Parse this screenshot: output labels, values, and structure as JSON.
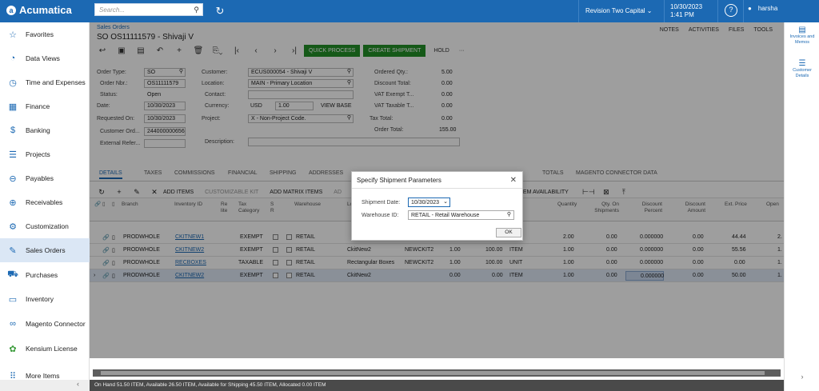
{
  "topbar": {
    "logo": "Acumatica",
    "search_placeholder": "Search...",
    "tenant": "Revision Two Capital",
    "date": "10/30/2023",
    "time": "1:41 PM",
    "user": "harsha"
  },
  "sidebar": {
    "items": [
      {
        "label": "Favorites",
        "icon": "star-icon"
      },
      {
        "label": "Data Views",
        "icon": "pie-chart-icon"
      },
      {
        "label": "Time and Expenses",
        "icon": "clock-icon"
      },
      {
        "label": "Finance",
        "icon": "calculator-icon"
      },
      {
        "label": "Banking",
        "icon": "dollar-icon"
      },
      {
        "label": "Projects",
        "icon": "projects-icon"
      },
      {
        "label": "Payables",
        "icon": "minus-circle-icon"
      },
      {
        "label": "Receivables",
        "icon": "plus-circle-icon"
      },
      {
        "label": "Customization",
        "icon": "customization-icon"
      },
      {
        "label": "Sales Orders",
        "icon": "sales-orders-icon"
      },
      {
        "label": "Purchases",
        "icon": "cart-icon"
      },
      {
        "label": "Inventory",
        "icon": "truck-icon"
      },
      {
        "label": "Magento Connector",
        "icon": "magento-icon"
      },
      {
        "label": "Kensium License",
        "icon": "kensium-icon"
      },
      {
        "label": "More Items",
        "icon": "grid-icon"
      }
    ]
  },
  "page": {
    "breadcrumb": "Sales Orders",
    "title": "SO OS11111579 - Shivaji V",
    "links": [
      "NOTES",
      "ACTIVITIES",
      "FILES",
      "TOOLS"
    ],
    "actions": {
      "process": "QUICK PROCESS",
      "shipment": "CREATE SHIPMENT",
      "hold": "HOLD",
      "more": "···"
    }
  },
  "form": {
    "order_type_label": "Order Type:",
    "order_type": "SO",
    "order_nbr_label": "Order Nbr.:",
    "order_nbr": "OS11111579",
    "status_label": "Status:",
    "status": "Open",
    "date_label": "Date:",
    "date": "10/30/2023",
    "requested_label": "Requested On:",
    "requested": "10/30/2023",
    "customer_ord_label": "Customer Ord...",
    "customer_ord": "244000000656",
    "external_label": "External Refer...",
    "external": "",
    "customer_label": "Customer:",
    "customer": "ECUS000054 - Shivaji V",
    "location_label": "Location:",
    "location": "MAIN - Primary Location",
    "contact_label": "Contact:",
    "contact": "",
    "currency_label": "Currency:",
    "currency": "USD",
    "rate": "1.00",
    "view_base": "VIEW BASE",
    "project_label": "Project:",
    "project": "X - Non-Project Code.",
    "description_label": "Description:",
    "description": "",
    "ordered_qty_label": "Ordered Qty.:",
    "ordered_qty": "5.00",
    "discount_label": "Discount Total:",
    "discount": "0.00",
    "vat_exempt_label": "VAT Exempt T...",
    "vat_exempt": "0.00",
    "vat_taxable_label": "VAT Taxable T...",
    "vat_taxable": "0.00",
    "tax_total_label": "Tax Total:",
    "tax_total": "0.00",
    "order_total_label": "Order Total:",
    "order_total": "155.00"
  },
  "tabs": [
    "DETAILS",
    "TAXES",
    "COMMISSIONS",
    "FINANCIAL",
    "SHIPPING",
    "ADDRESSES",
    "TOTALS",
    "MAGENTO CONNECTOR DATA"
  ],
  "grid_toolbar": [
    "ADD ITEMS",
    "CUSTOMIZABLE KIT",
    "ADD MATRIX ITEMS",
    "AD",
    "K",
    "ITEM AVAILABILITY"
  ],
  "grid": {
    "headers": [
      "Branch",
      "Inventory ID",
      "Re lite",
      "Tax Category",
      "S R",
      "Warehouse",
      "Lo",
      "Quantity",
      "Qty. On Shipments",
      "Discount Percent",
      "Discount Amount",
      "Ext. Price",
      "Open"
    ],
    "rows": [
      {
        "branch": "PRODWHOLE",
        "inventory": "CKITNEW1",
        "tax": "EXEMPT",
        "warehouse": "RETAIL",
        "desc": "",
        "kit": "",
        "q1": "",
        "q2": "",
        "uom": "",
        "qty": "2.00",
        "qty_ship": "0.00",
        "disc_pct": "0.000000",
        "disc_amt": "0.00",
        "ext": "44.44",
        "open": "2."
      },
      {
        "branch": "PRODWHOLE",
        "inventory": "CKITNEW2",
        "tax": "EXEMPT",
        "warehouse": "RETAIL",
        "desc": "CkitNew2",
        "kit": "NEWCKIT2",
        "q1": "1.00",
        "q2": "100.00",
        "uom": "ITEM",
        "qty": "1.00",
        "qty_ship": "0.00",
        "disc_pct": "0.000000",
        "disc_amt": "0.00",
        "ext": "55.56",
        "open": "1."
      },
      {
        "branch": "PRODWHOLE",
        "inventory": "RECBOXES",
        "tax": "TAXABLE",
        "warehouse": "RETAIL",
        "desc": "Rectangular Boxes",
        "kit": "NEWCKIT2",
        "q1": "1.00",
        "q2": "100.00",
        "uom": "UNIT",
        "qty": "1.00",
        "qty_ship": "0.00",
        "disc_pct": "0.000000",
        "disc_amt": "0.00",
        "ext": "0.00",
        "open": "1."
      },
      {
        "branch": "PRODWHOLE",
        "inventory": "CKITNEW2",
        "tax": "EXEMPT",
        "warehouse": "RETAIL",
        "desc": "CkitNew2",
        "kit": "",
        "q1": "0.00",
        "q2": "0.00",
        "uom": "ITEM",
        "qty": "1.00",
        "qty_ship": "0.00",
        "disc_pct": "0.000000",
        "disc_amt": "0.00",
        "ext": "50.00",
        "open": "1."
      }
    ]
  },
  "status_bar": "On Hand 51.50 ITEM, Available 26.50 ITEM, Available for Shipping 45.50 ITEM, Allocated 0.00 ITEM",
  "right_panel": [
    "Invoices and Memos",
    "Customer Details"
  ],
  "dialog": {
    "title": "Specify Shipment Parameters",
    "shipment_date_label": "Shipment Date:",
    "shipment_date": "10/30/2023",
    "warehouse_label": "Warehouse ID:",
    "warehouse": "RETAIL - Retail Warehouse",
    "ok": "OK"
  }
}
